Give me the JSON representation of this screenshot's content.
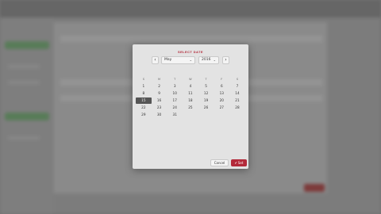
{
  "modal": {
    "title": "SELECT DATE",
    "prev_icon": "‹",
    "next_icon": "›",
    "month": "May",
    "year": "2016",
    "weekdays": [
      "S",
      "M",
      "T",
      "W",
      "T",
      "F",
      "S"
    ],
    "weeks": [
      [
        "1",
        "2",
        "3",
        "4",
        "5",
        "6",
        "7"
      ],
      [
        "8",
        "9",
        "10",
        "11",
        "12",
        "13",
        "14"
      ],
      [
        "15",
        "16",
        "17",
        "18",
        "19",
        "20",
        "21"
      ],
      [
        "22",
        "23",
        "24",
        "25",
        "26",
        "27",
        "28"
      ],
      [
        "29",
        "30",
        "31",
        "",
        "",
        "",
        ""
      ]
    ],
    "selected_day": "15",
    "cancel_label": "Cancel",
    "set_label": "Set",
    "accent_color": "#b32a3a"
  }
}
